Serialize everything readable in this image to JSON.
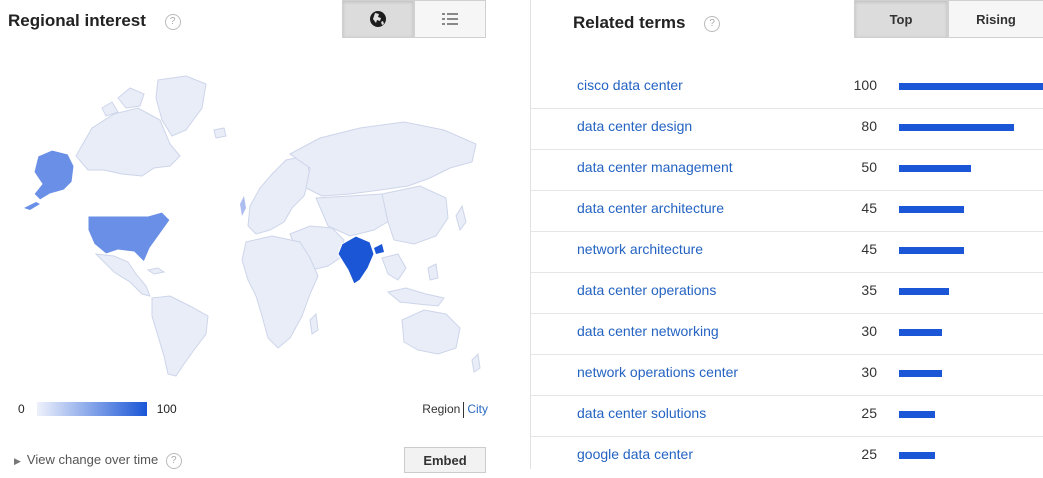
{
  "regional": {
    "title": "Regional interest",
    "help": "?",
    "map_view_icon": "globe-icon",
    "list_view_icon": "list-icon",
    "legend_min": "0",
    "legend_max": "100",
    "region_label": "Region",
    "city_label": "City",
    "view_change_label": "View change over time",
    "embed_label": "Embed",
    "colors": {
      "low": "#eef1fb",
      "mid": "#6a8fe6",
      "high": "#1a56d6"
    }
  },
  "related": {
    "title": "Related terms",
    "help": "?",
    "tabs": [
      {
        "label": "Top",
        "active": true
      },
      {
        "label": "Rising",
        "active": false
      }
    ],
    "rows": [
      {
        "term": "cisco data center",
        "value": "100"
      },
      {
        "term": "data center design",
        "value": "80"
      },
      {
        "term": "data center management",
        "value": "50"
      },
      {
        "term": "data center architecture",
        "value": "45"
      },
      {
        "term": "network architecture",
        "value": "45"
      },
      {
        "term": "data center operations",
        "value": "35"
      },
      {
        "term": "data center networking",
        "value": "30"
      },
      {
        "term": "network operations center",
        "value": "30"
      },
      {
        "term": "data center solutions",
        "value": "25"
      },
      {
        "term": "google data center",
        "value": "25"
      }
    ]
  }
}
